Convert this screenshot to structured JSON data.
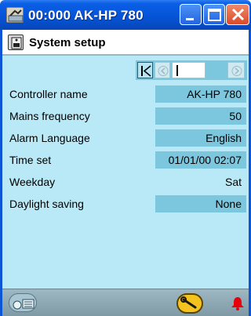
{
  "window": {
    "title": "00:000 AK-HP 780",
    "app_icon": "controller-icon",
    "buttons": [
      "minimize-icon",
      "maximize-icon",
      "close-icon"
    ]
  },
  "header": {
    "icon": "setup-icon",
    "title": "System setup"
  },
  "nav": {
    "first": "first-page-icon",
    "prev": "prev-page-icon",
    "next": "next-page-icon"
  },
  "rows": [
    {
      "label": "Controller name",
      "value": "AK-HP 780"
    },
    {
      "label": "Mains frequency",
      "value": "50"
    },
    {
      "label": "Alarm Language",
      "value": "English"
    },
    {
      "label": "Time set",
      "value": "01/01/00 02:07"
    },
    {
      "label": "Weekday",
      "value": "Sat"
    },
    {
      "label": "Daylight saving",
      "value": "None"
    }
  ],
  "statusbar": {
    "left_icon": "connection-icon",
    "wrench_icon": "wrench-icon",
    "alarm_icon": "alarm-bell-icon"
  },
  "colors": {
    "client_bg": "#b9e9f7",
    "value_bg": "#7cc7de",
    "titlebar": "#0554d8",
    "alarm": "#e8000a"
  }
}
